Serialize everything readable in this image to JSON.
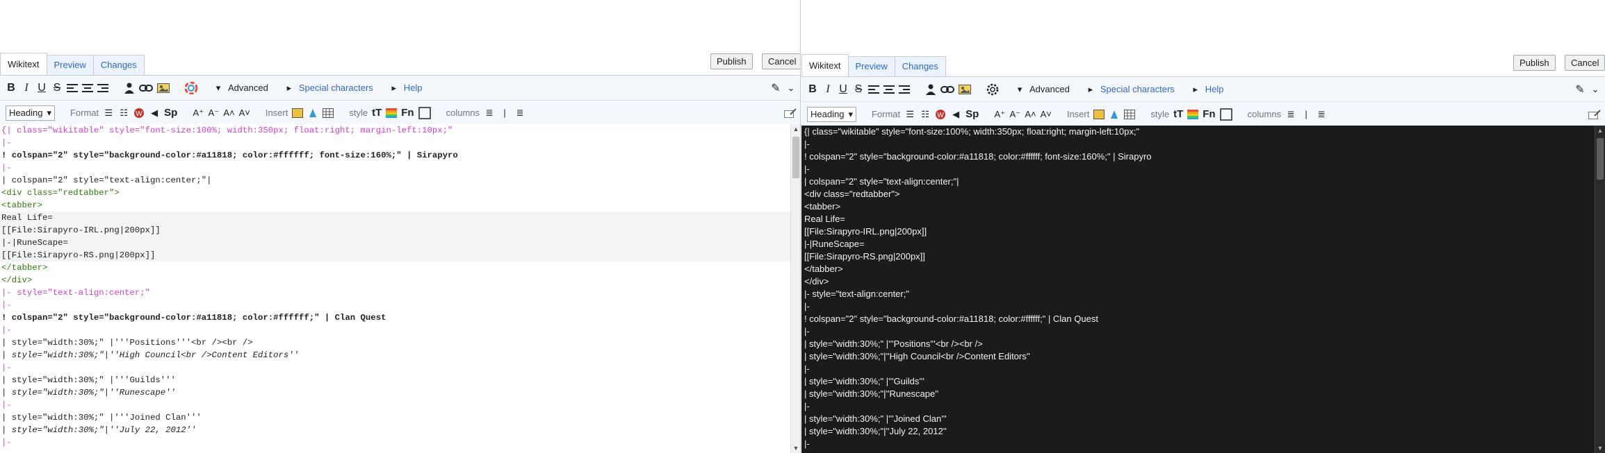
{
  "left": {
    "tabs": [
      "Wikitext",
      "Preview",
      "Changes"
    ],
    "publish_label": "Publish",
    "cancel_label": "Cancel",
    "toolbar": {
      "row1": {
        "bold": "B",
        "italic": "I",
        "underline": "U",
        "strike": "S",
        "advanced": "Advanced",
        "special_characters": "Special characters",
        "help": "Help"
      },
      "row2": {
        "heading_select": "Heading",
        "format": "Format",
        "sp": "Sp",
        "insert": "Insert",
        "style": "style",
        "tT": "tT",
        "fn": "Fn",
        "columns": "columns"
      }
    },
    "lines": [
      "{| class=\"wikitable\" style=\"font-size:100%; width:350px; float:right; margin-left:10px;\"",
      "|-",
      "! colspan=\"2\" style=\"background-color:#a11818; color:#ffffff; font-size:160%;\" | Sirapyro",
      "|-",
      "| colspan=\"2\" style=\"text-align:center;\"|",
      "<div class=\"redtabber\">",
      "<tabber>",
      "Real Life=",
      "[[File:Sirapyro-IRL.png|200px]]",
      "|-|RuneScape=",
      "[[File:Sirapyro-RS.png|200px]]",
      "</tabber>",
      "</div>",
      "|- style=\"text-align:center;\"",
      "|-",
      "! colspan=\"2\" style=\"background-color:#a11818; color:#ffffff;\" | Clan Quest",
      "|-",
      "| style=\"width:30%;\" |'''Positions'''<br /><br />",
      "| style=\"width:30%;\"|''High Council<br />Content Editors''",
      "|-",
      "| style=\"width:30%;\" |'''Guilds'''",
      "| style=\"width:30%;\"|''Runescape''",
      "|-",
      "| style=\"width:30%;\" |'''Joined Clan'''",
      "| style=\"width:30%;\"|''July 22, 2012''",
      "|-"
    ]
  },
  "right": {
    "tabs": [
      "Wikitext",
      "Preview",
      "Changes"
    ],
    "publish_label": "Publish",
    "cancel_label": "Cancel",
    "toolbar": {
      "row1": {
        "bold": "B",
        "italic": "I",
        "underline": "U",
        "strike": "S",
        "advanced": "Advanced",
        "special_characters": "Special characters",
        "help": "Help"
      },
      "row2": {
        "heading_select": "Heading",
        "format": "Format",
        "sp": "Sp",
        "insert": "Insert",
        "style": "style",
        "tT": "tT",
        "fn": "Fn",
        "columns": "columns"
      }
    },
    "lines": [
      "{| class=\"wikitable\" style=\"font-size:100%; width:350px; float:right; margin-left:10px;\"",
      "|-",
      "! colspan=\"2\" style=\"background-color:#a11818; color:#ffffff; font-size:160%;\" | Sirapyro",
      "|-",
      "| colspan=\"2\" style=\"text-align:center;\"|",
      "<div class=\"redtabber\">",
      "<tabber>",
      "Real Life=",
      "[[File:Sirapyro-IRL.png|200px]]",
      "|-|RuneScape=",
      "[[File:Sirapyro-RS.png|200px]]",
      "</tabber>",
      "</div>",
      "|- style=\"text-align:center;\"",
      "|-",
      "! colspan=\"2\" style=\"background-color:#a11818; color:#ffffff;\" | Clan Quest",
      "|-",
      "| style=\"width:30%;\" |'''Positions'''<br /><br />",
      "| style=\"width:30%;\"|''High Council<br />Content Editors''",
      "|-",
      "| style=\"width:30%;\" |'''Guilds'''",
      "| style=\"width:30%;\"|''Runescape''",
      "|-",
      "| style=\"width:30%;\" |'''Joined Clan'''",
      "| style=\"width:30%;\"|''July 22, 2012''",
      "|-"
    ]
  },
  "icons": {
    "align_left": "align-left-icon",
    "align_center": "align-center-icon",
    "align_right": "align-right-icon",
    "user": "user-icon",
    "link": "link-icon",
    "image": "image-icon",
    "color_wheel": "color-wheel-icon",
    "pencil": "pencil-icon",
    "chevron": "chevron-down-icon"
  },
  "colors": {
    "link": "#3366cc",
    "syntax_pink": "#d33dd3",
    "syntax_green": "#2b7a0b",
    "dark_editor_bg": "#1b1b1b",
    "toolbar_bg": "#f4f7fb"
  }
}
